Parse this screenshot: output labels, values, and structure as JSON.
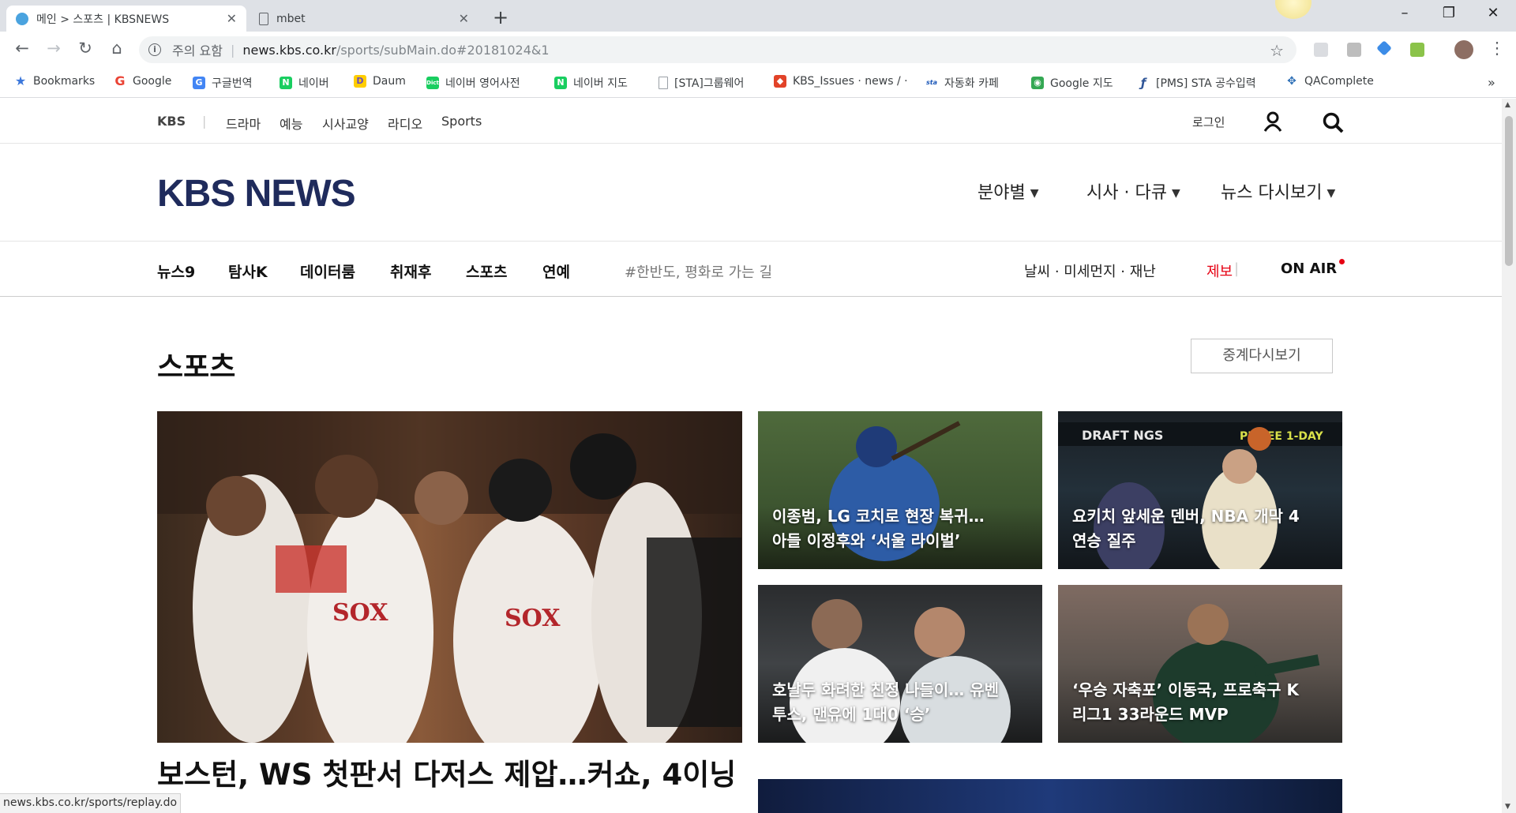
{
  "browser": {
    "tabs": [
      {
        "title": "메인 > 스포츠 | KBSNEWS",
        "active": true
      },
      {
        "title": "mbet",
        "active": false
      }
    ],
    "new_tab": "+",
    "window_controls": {
      "minimize": "–",
      "maximize": "❐",
      "close": "✕"
    },
    "nav": {
      "back": "←",
      "forward": "→",
      "reload": "↻",
      "home": "⌂"
    },
    "address": {
      "security_label": "주의 요함",
      "host": "news.kbs.co.kr",
      "path": "/sports/subMain.do#20181024&1"
    },
    "bookmarks": [
      {
        "label": "Bookmarks",
        "icon": "star-icon",
        "color": "#3b77db"
      },
      {
        "label": "Google",
        "icon": "google-icon",
        "color": "#ea4335"
      },
      {
        "label": "구글번역",
        "icon": "translate-icon",
        "color": "#4285f4"
      },
      {
        "label": "네이버",
        "icon": "naver-icon",
        "color": "#19ce60"
      },
      {
        "label": "Daum",
        "icon": "daum-icon",
        "color": "#ffcd00"
      },
      {
        "label": "네이버 영어사전",
        "icon": "dict-icon",
        "color": "#19ce60"
      },
      {
        "label": "네이버 지도",
        "icon": "naver-icon",
        "color": "#19ce60"
      },
      {
        "label": "[STA]그룹웨어",
        "icon": "page-icon",
        "color": "#9aa0a6"
      },
      {
        "label": "KBS_Issues · news / ·",
        "icon": "gitlab-icon",
        "color": "#e24329"
      },
      {
        "label": "자동화 카페",
        "icon": "sta-icon",
        "color": "#1a56b7"
      },
      {
        "label": "Google 지도",
        "icon": "maps-icon",
        "color": "#34a853"
      },
      {
        "label": "[PMS] STA 공수입력",
        "icon": "pms-icon",
        "color": "#2f5597"
      },
      {
        "label": "QAComplete",
        "icon": "qa-icon",
        "color": "#2d6fb6"
      }
    ],
    "bookmarks_overflow": "»",
    "status_url": "news.kbs.co.kr/sports/replay.do"
  },
  "util_bar": {
    "brand": "KBS",
    "links": [
      "드라마",
      "예능",
      "시사교양",
      "라디오",
      "Sports"
    ],
    "login": "로그인"
  },
  "header": {
    "logo": "KBS NEWS",
    "menus": [
      "분야별",
      "시사 · 다큐",
      "뉴스 다시보기"
    ]
  },
  "gnb": {
    "items": [
      "뉴스9",
      "탐사K",
      "데이터룸",
      "취재후",
      "스포츠",
      "연예"
    ],
    "hashtag": "#한반도, 평화로 가는 길",
    "weather": "날씨 · 미세먼지 · 재난",
    "report": "제보",
    "on_air": "ON AIR",
    "accent_color": "#e60012"
  },
  "main": {
    "section_title": "스포츠",
    "replay_button": "중계다시보기",
    "headline": "보스턴, WS 첫판서 다저스 제압…커쇼, 4이닝",
    "cards": [
      {
        "caption": "이종범, LG 코치로 현장 복귀… 아들 이정후와 ‘서울 라이벌’"
      },
      {
        "caption": "요키치 앞세운 덴버, NBA 개막 4연승 질주"
      },
      {
        "caption": "호날두 화려한 친정 나들이… 유벤투스, 맨유에 1대0 ‘승’"
      },
      {
        "caption": "‘우승 자축포’ 이동국, 프로축구 K리그1 33라운드 MVP"
      }
    ]
  }
}
